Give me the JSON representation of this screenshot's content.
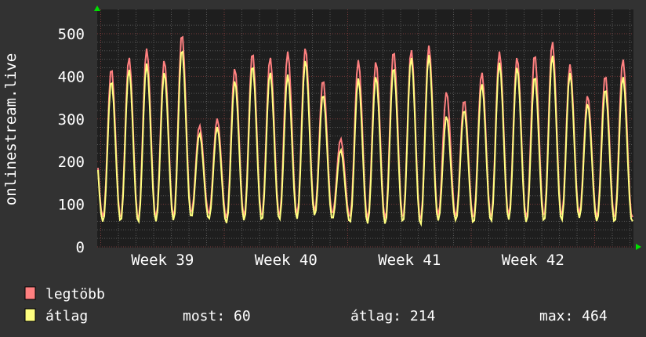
{
  "chart_data": {
    "type": "line",
    "ylabel": "onlinestream.live",
    "ylim": [
      0,
      520
    ],
    "xlim_days": [
      0,
      30.4
    ],
    "yticks": [
      0,
      100,
      200,
      300,
      400,
      500
    ],
    "ytick_labels": [
      "0",
      "100",
      "200",
      "300",
      "400",
      "500"
    ],
    "xtick_labels": [
      "Week 39",
      "Week 40",
      "Week 41",
      "Week 42"
    ],
    "xtick_days": [
      3.7,
      10.7,
      17.7,
      24.7
    ],
    "week_boundary_days": [
      0.2,
      7.2,
      14.2,
      21.2,
      28.2
    ],
    "grid": true,
    "series": [
      {
        "name": "legtöbb",
        "color": "#ff8080",
        "daily_peaks": [
          419,
          445,
          465,
          438,
          500,
          285,
          301,
          419,
          456,
          445,
          458,
          467,
          392,
          254,
          438,
          435,
          460,
          463,
          472,
          364,
          345,
          410,
          458,
          445,
          452,
          482,
          428,
          355,
          403,
          441
        ],
        "daily_troughs": [
          70,
          68,
          66,
          68,
          70,
          80,
          78,
          68,
          72,
          72,
          74,
          76,
          84,
          78,
          70,
          66,
          66,
          68,
          64,
          74,
          72,
          68,
          70,
          74,
          68,
          72,
          74,
          78,
          70,
          68
        ]
      },
      {
        "name": "átlag",
        "color": "#ffff80",
        "daily_peaks": [
          390,
          417,
          430,
          410,
          465,
          266,
          281,
          390,
          426,
          410,
          404,
          438,
          358,
          228,
          395,
          400,
          422,
          445,
          450,
          307,
          322,
          383,
          432,
          422,
          401,
          450,
          408,
          336,
          371,
          400
        ],
        "daily_troughs": [
          59,
          60,
          58,
          60,
          62,
          70,
          66,
          56,
          62,
          62,
          64,
          66,
          74,
          66,
          58,
          55,
          54,
          58,
          52,
          62,
          62,
          56,
          60,
          64,
          58,
          60,
          62,
          68,
          60,
          58
        ]
      }
    ],
    "start_value": 248,
    "end_value": 60
  },
  "legend": {
    "items": [
      {
        "label": "legtöbb",
        "color": "#ff8080"
      },
      {
        "label": "átlag",
        "color": "#ffff80"
      }
    ],
    "stats": {
      "now": "most: 60",
      "avg": "átlag: 214",
      "max": "max: 464"
    }
  },
  "colors": {
    "background": "#323232",
    "plot": "#1e1e1e",
    "grid_minor": "#555555",
    "grid_major": "#7a3a3a",
    "arrow": "#00e000"
  }
}
